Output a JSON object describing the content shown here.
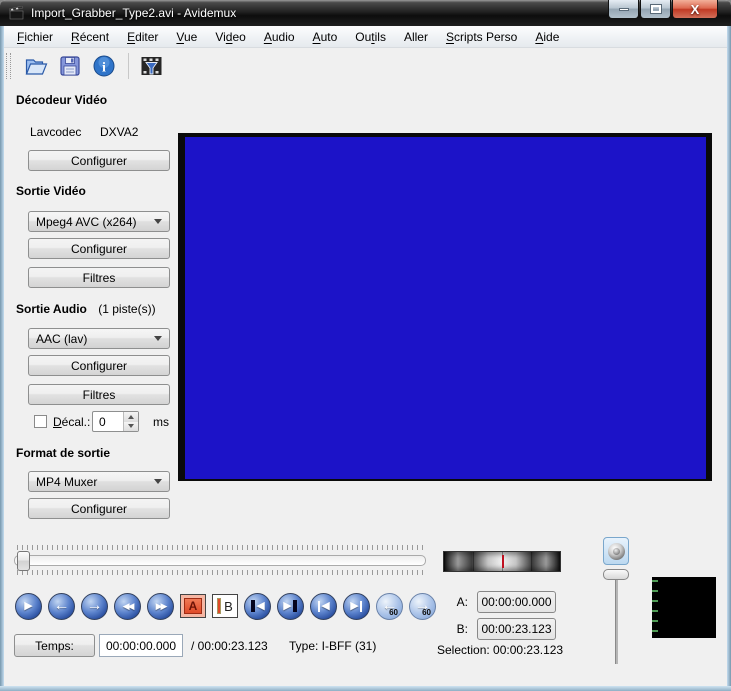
{
  "window": {
    "title": "Import_Grabber_Type2.avi - Avidemux",
    "controls": [
      {
        "id": "minimize",
        "name": "minimize-button"
      },
      {
        "id": "maximize",
        "name": "maximize-button"
      },
      {
        "id": "close",
        "name": "close-button"
      }
    ]
  },
  "menu": {
    "items": [
      {
        "id": "fichier",
        "label": "Fichier",
        "u": 0
      },
      {
        "id": "recent",
        "label": "Récent",
        "u": 0
      },
      {
        "id": "editer",
        "label": "Editer",
        "u": 0
      },
      {
        "id": "vue",
        "label": "Vue",
        "u": 0
      },
      {
        "id": "video",
        "label": "Video",
        "u": 2
      },
      {
        "id": "audio",
        "label": "Audio",
        "u": 0
      },
      {
        "id": "auto",
        "label": "Auto",
        "u": 0
      },
      {
        "id": "outils",
        "label": "Outils",
        "u": 2
      },
      {
        "id": "aller",
        "label": "Aller",
        "u": -1
      },
      {
        "id": "scripts-perso",
        "label": "Scripts Perso",
        "u": 0
      },
      {
        "id": "aide",
        "label": "Aide",
        "u": 0
      }
    ]
  },
  "toolbar": {
    "icons": [
      "open",
      "save",
      "information",
      "video-filters"
    ]
  },
  "panel": {
    "decoder": {
      "title": "Décodeur Vidéo",
      "codec": "Lavcodec",
      "accel": "DXVA2",
      "configure_label": "Configurer"
    },
    "video_out": {
      "title": "Sortie Vidéo",
      "codec": "Mpeg4 AVC (x264)",
      "configure_label": "Configurer",
      "filters_label": "Filtres"
    },
    "audio_out": {
      "title": "Sortie Audio",
      "tracks": "(1 piste(s))",
      "codec": "AAC (lav)",
      "configure_label": "Configurer",
      "filters_label": "Filtres",
      "shift_label": "Décal.:",
      "shift_value": "0",
      "shift_unit": "ms"
    },
    "format": {
      "title": "Format de sortie",
      "muxer": "MP4 Muxer",
      "configure_label": "Configurer"
    }
  },
  "transport": {
    "buttons": [
      {
        "name": "play-button",
        "kind": "circle",
        "arrow": "▶"
      },
      {
        "name": "prev-frame-button",
        "kind": "circle",
        "arrow": "←"
      },
      {
        "name": "next-frame-button",
        "kind": "circle",
        "arrow": "→"
      },
      {
        "name": "prev-keyframe-button",
        "kind": "circle",
        "arrow": "◀◀"
      },
      {
        "name": "next-keyframe-button",
        "kind": "circle",
        "arrow": "▶▶"
      },
      {
        "name": "marker-a-button",
        "kind": "marker-a",
        "label": "A"
      },
      {
        "name": "marker-b-button",
        "kind": "marker-b",
        "label": "B"
      },
      {
        "name": "prev-black-frame-button",
        "kind": "circle",
        "arrow": "◀",
        "bar": "left"
      },
      {
        "name": "next-black-frame-button",
        "kind": "circle",
        "arrow": "▶",
        "bar": "right"
      },
      {
        "name": "first-frame-button",
        "kind": "circle",
        "arrow": "◀",
        "bar2": "left"
      },
      {
        "name": "last-frame-button",
        "kind": "circle",
        "arrow": "▶",
        "bar2": "right"
      },
      {
        "name": "back-one-minute-button",
        "kind": "circle-light",
        "arrow": "←",
        "sub": "60"
      },
      {
        "name": "forward-one-minute-button",
        "kind": "circle-light",
        "arrow": "→",
        "sub": "60"
      }
    ]
  },
  "markers": {
    "a_label": "A:",
    "a_value": "00:00:00.000",
    "b_label": "B:",
    "b_value": "00:00:23.123",
    "selection": "Selection: 00:00:23.123"
  },
  "status": {
    "time_button_label": "Temps:",
    "current_time": "00:00:00.000",
    "total_time": "/ 00:00:23.123",
    "frame_type": "Type: I-BFF (31)"
  },
  "colors": {
    "video_blue": "#1c13c8",
    "marker_red": "#e04a28",
    "close_red": "#c13a24",
    "nav_blue": "#2a4fa0"
  }
}
